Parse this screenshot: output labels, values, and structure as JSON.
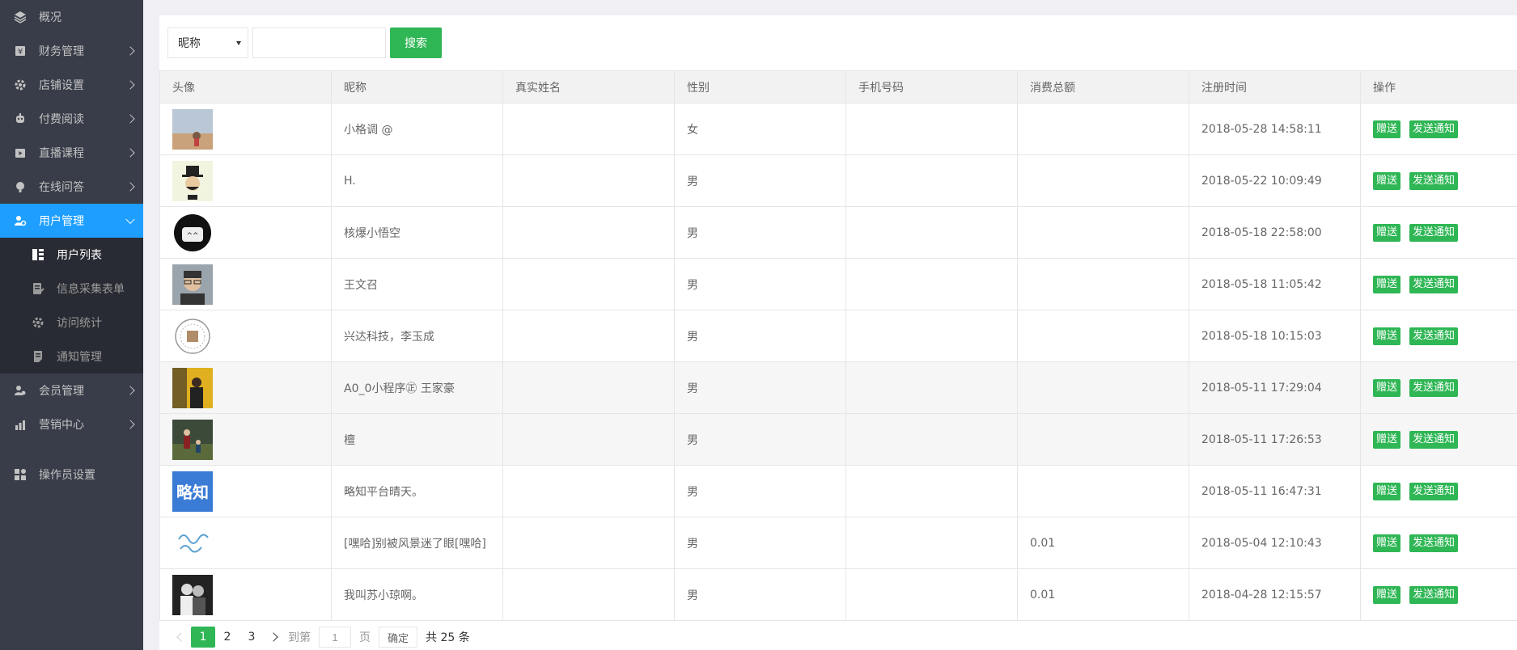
{
  "sidebar": {
    "items": [
      {
        "label": "概况",
        "icon": "layers-icon"
      },
      {
        "label": "财务管理",
        "icon": "finance-icon"
      },
      {
        "label": "店铺设置",
        "icon": "gear-icon"
      },
      {
        "label": "付费阅读",
        "icon": "robot-icon"
      },
      {
        "label": "直播课程",
        "icon": "video-icon"
      },
      {
        "label": "在线问答",
        "icon": "question-icon"
      },
      {
        "label": "用户管理",
        "icon": "user-settings-icon"
      }
    ],
    "sub_items": [
      {
        "label": "用户列表",
        "icon": "list-icon"
      },
      {
        "label": "信息采集表单",
        "icon": "form-icon"
      },
      {
        "label": "访问统计",
        "icon": "gear-icon"
      },
      {
        "label": "通知管理",
        "icon": "note-icon"
      }
    ],
    "items2": [
      {
        "label": "会员管理",
        "icon": "member-icon"
      },
      {
        "label": "营销中心",
        "icon": "chart-icon"
      }
    ],
    "operator": {
      "label": "操作员设置",
      "icon": "apps-icon"
    }
  },
  "toolbar": {
    "select_value": "昵称",
    "search_placeholder": "",
    "search_label": "搜索"
  },
  "table": {
    "headers": [
      "头像",
      "昵称",
      "真实姓名",
      "性别",
      "手机号码",
      "消费总额",
      "注册时间",
      "操作"
    ],
    "action_gift": "赠送",
    "action_notify": "发送通知",
    "rows": [
      {
        "nickname": "小格调 @",
        "real_name": "",
        "gender": "女",
        "phone": "",
        "total": "",
        "time": "2018-05-28 14:58:11",
        "avatar": "landscape"
      },
      {
        "nickname": "H.",
        "real_name": "",
        "gender": "男",
        "phone": "",
        "total": "",
        "time": "2018-05-22 10:09:49",
        "avatar": "hat"
      },
      {
        "nickname": "核爆小悟空",
        "real_name": "",
        "gender": "男",
        "phone": "",
        "total": "",
        "time": "2018-05-18 22:58:00",
        "avatar": "meme"
      },
      {
        "nickname": "王文召",
        "real_name": "",
        "gender": "男",
        "phone": "",
        "total": "",
        "time": "2018-05-18 11:05:42",
        "avatar": "portrait"
      },
      {
        "nickname": "兴达科技，李玉成",
        "real_name": "",
        "gender": "男",
        "phone": "",
        "total": "",
        "time": "2018-05-18 10:15:03",
        "avatar": "seal"
      },
      {
        "nickname": "A0_0小程序㊣ 王家豪",
        "real_name": "",
        "gender": "男",
        "phone": "",
        "total": "",
        "time": "2018-05-11 17:29:04",
        "avatar": "yellow"
      },
      {
        "nickname": "檀",
        "real_name": "",
        "gender": "男",
        "phone": "",
        "total": "",
        "time": "2018-05-11 17:26:53",
        "avatar": "park"
      },
      {
        "nickname": "略知平台晴天。",
        "real_name": "",
        "gender": "男",
        "phone": "",
        "total": "",
        "time": "2018-05-11 16:47:31",
        "avatar": "logo",
        "avatar_text": "略知"
      },
      {
        "nickname": "[嘿哈]别被风景迷了眼[嘿哈]",
        "real_name": "",
        "gender": "男",
        "phone": "",
        "total": "0.01",
        "time": "2018-05-04 12:10:43",
        "avatar": "handwriting"
      },
      {
        "nickname": "我叫苏小琼啊。",
        "real_name": "",
        "gender": "男",
        "phone": "",
        "total": "0.01",
        "time": "2018-04-28 12:15:57",
        "avatar": "couple"
      }
    ]
  },
  "pager": {
    "pages": [
      "1",
      "2",
      "3"
    ],
    "goto_label": "到第",
    "goto_value": "1",
    "page_label": "页",
    "ok_label": "确定",
    "total_label": "共 25 条"
  },
  "colors": {
    "sidebar": "#393d49",
    "active": "#1e9fff",
    "primary": "#2fb655"
  }
}
